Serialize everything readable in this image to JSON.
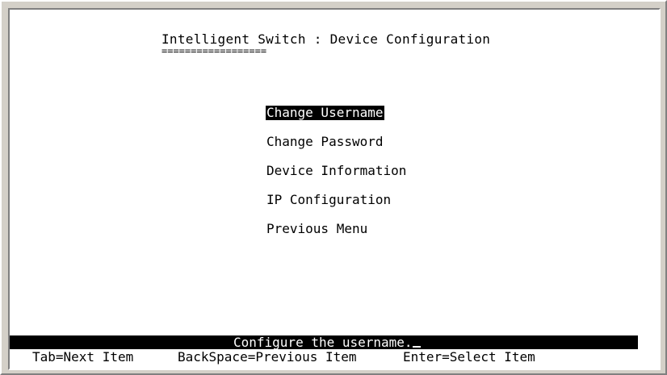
{
  "header": {
    "title": "Intelligent Switch : Device Configuration",
    "underline": "=================="
  },
  "menu": {
    "items": [
      {
        "label": "Change Username",
        "selected": true
      },
      {
        "label": "Change Password",
        "selected": false
      },
      {
        "label": "Device Information",
        "selected": false
      },
      {
        "label": "IP Configuration",
        "selected": false
      },
      {
        "label": "Previous Menu",
        "selected": false
      }
    ]
  },
  "status": {
    "message": "Configure the username."
  },
  "help": {
    "next": "Tab=Next Item",
    "previous": "BackSpace=Previous Item",
    "select": "Enter=Select Item"
  },
  "colors": {
    "background": "#ffffff",
    "text": "#000000",
    "highlight_bg": "#000000",
    "highlight_fg": "#ffffff",
    "window_frame": "#d4d0c8"
  }
}
